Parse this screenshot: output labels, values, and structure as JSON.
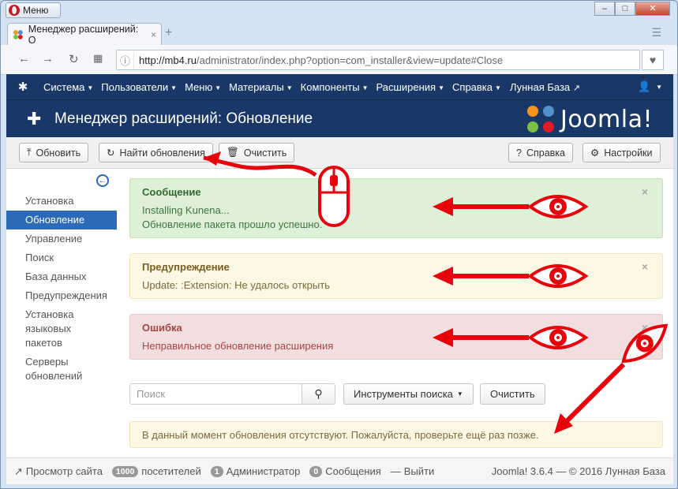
{
  "browser": {
    "menu_label": "Меню",
    "tab_title": "Менеджер расширений: О",
    "tab_close": "×",
    "tab_add": "+",
    "url_host": "http://mb4.ru",
    "url_path": "/administrator/index.php?option=com_installer&view=update#Close"
  },
  "nav": {
    "items": [
      "Система",
      "Пользователи",
      "Меню",
      "Материалы",
      "Компоненты",
      "Расширения",
      "Справка"
    ],
    "site": "Лунная База"
  },
  "header": {
    "title": "Менеджер расширений: Обновление",
    "brand": "Joomla!"
  },
  "toolbar": {
    "update": "Обновить",
    "find_updates": "Найти обновления",
    "clear": "Очистить",
    "help": "Справка",
    "settings": "Настройки"
  },
  "sidebar": {
    "items": [
      "Установка",
      "Обновление",
      "Управление",
      "Поиск",
      "База данных",
      "Предупреждения",
      "Установка языковых пакетов",
      "Серверы обновлений"
    ],
    "active_index": 1
  },
  "alerts": {
    "success": {
      "heading": "Сообщение",
      "line1": "Installing Kunena...",
      "line2": "Обновление пакета прошло успешно."
    },
    "warning": {
      "heading": "Предупреждение",
      "line1": "Update: :Extension: Не удалось открыть"
    },
    "error": {
      "heading": "Ошибка",
      "line1": "Неправильное обновление расширения"
    },
    "close_glyph": "×"
  },
  "filters": {
    "search_placeholder": "Поиск",
    "search_tools": "Инструменты поиска",
    "clear": "Очистить"
  },
  "notice": "В данный момент обновления отсутствуют. Пожалуйста, проверьте ещё раз позже.",
  "status": {
    "view_site": "Просмотр сайта",
    "visitors_count": "1000",
    "visitors_label": "посетителей",
    "admins_count": "1",
    "admins_label": "Администратор",
    "messages_count": "0",
    "messages_label": "Сообщения",
    "logout": "Выйти",
    "version": "Joomla! 3.6.4 — © 2016 Лунная База"
  },
  "colors": {
    "navy": "#1a3867",
    "accent": "#2d6ab8",
    "annotation_red": "#e8000b"
  },
  "icons": [
    "opera-logo-icon",
    "joomla-tab-icon",
    "back-arrow-icon",
    "forward-arrow-icon",
    "reload-icon",
    "grid-icon",
    "page-info-icon",
    "heart-icon",
    "joomla-icon",
    "user-icon",
    "puzzle-icon",
    "upload-icon",
    "refresh-icon",
    "trash-icon",
    "question-icon",
    "gear-icon",
    "collapse-icon",
    "search-icon",
    "external-link-icon",
    "minus-icon",
    "mouse-icon",
    "eye-icon"
  ]
}
